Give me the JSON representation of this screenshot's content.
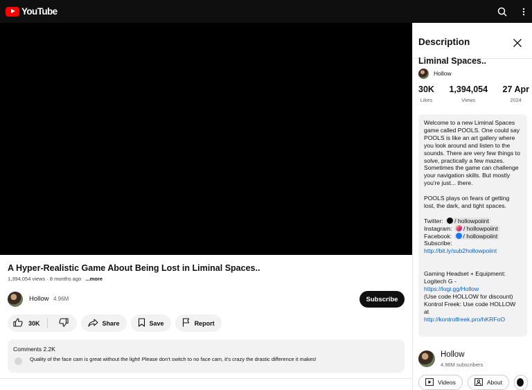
{
  "app": {
    "logo_text": "YouTube",
    "brand_color": "#ff0000"
  },
  "topbar": {
    "icons": [
      "search-icon",
      "more-vert-icon"
    ]
  },
  "video": {
    "title": "A Hyper-Realistic Game About Being Lost in Liminal Spaces..",
    "views": "1,394,054 views",
    "age": "8 months ago",
    "more_label": "...more",
    "channel": "Hollow",
    "channel_subs": "4.96M",
    "subscribe_label": "Subscribe",
    "likes": "30K",
    "share_label": "Share",
    "save_label": "Save",
    "report_label": "Report"
  },
  "comments": {
    "title": "Comments 2.2K",
    "top_comment": "Quality of the face cam is great without the light! Please don't switch to no face cam, it's crazy the drastic difference it makes!"
  },
  "panel": {
    "title": "Description",
    "video_title": "Liminal Spaces..",
    "channel": "Hollow",
    "stats": [
      {
        "value": "30K",
        "label": "Likes"
      },
      {
        "value": "1,394,054",
        "label": "Views"
      },
      {
        "value": "27 Apr",
        "label": "2024"
      }
    ],
    "description": {
      "para1": "Welcome to a new Liminal Spaces game called POOLS. One could say POOLS is like an art gallery where you look around and listen to the sounds. There are very few things to solve, practically a few mazes. Sometimes the game can challenge your navigation skills. But mostly you're just... there.",
      "para2": "POOLS plays on fears of getting lost, the dark, and tight spaces.",
      "twitter_label": "Twitter:",
      "twitter_handle": "/ hollowpoiint",
      "instagram_label": "Instagram:",
      "instagram_handle": "/ hollowpoiint",
      "facebook_label": "Facebook:",
      "facebook_handle": "/ hollowpoiint",
      "subscribe_label": "Subscribe:",
      "subscribe_link": "http://bit.ly/sub2hollowpoiint",
      "gear_label": "Gaming Headset + Equipment: Logitech G -",
      "logitech_link": "https://logi.gg/Hollow",
      "logitech_code": "(Use code HOLLOW for discount)",
      "kontrol_text": "Kontrol Freek: Use code HOLLOW at",
      "kontrol_link": "http://kontrolfreek.pro/hKRFoO"
    },
    "channel_card": {
      "name": "Hollow",
      "subs": "4.96M subscribers",
      "videos_label": "Videos",
      "about_label": "About"
    }
  }
}
